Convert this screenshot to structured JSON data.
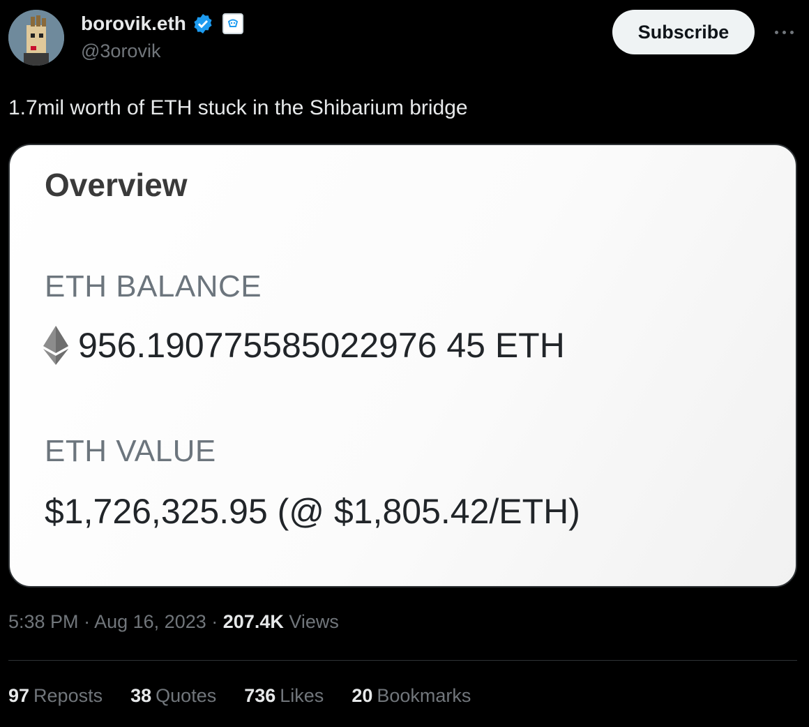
{
  "author": {
    "name": "borovik.eth",
    "handle": "@3orovik",
    "avatar_icon": "punk-avatar-icon",
    "verified_icon": "verified-badge-icon",
    "affiliation_icon": "affiliation-badge-icon"
  },
  "header": {
    "subscribe_label": "Subscribe",
    "more_icon": "more-options-icon"
  },
  "tweet": {
    "text": "1.7mil worth of ETH stuck in the Shibarium bridge"
  },
  "media": {
    "title": "Overview",
    "balance_label": "ETH BALANCE",
    "balance_value": "956.190775585022976 45 ETH",
    "value_label": "ETH VALUE",
    "value_amount": "$1,726,325.95 (@ $1,805.42/ETH)",
    "eth_icon": "ethereum-icon"
  },
  "meta": {
    "time": "5:38 PM",
    "separator": "·",
    "date": "Aug 16, 2023",
    "views_count": "207.4K",
    "views_label": "Views"
  },
  "stats": {
    "reposts_count": "97",
    "reposts_label": "Reposts",
    "quotes_count": "38",
    "quotes_label": "Quotes",
    "likes_count": "736",
    "likes_label": "Likes",
    "bookmarks_count": "20",
    "bookmarks_label": "Bookmarks"
  },
  "colors": {
    "background": "#000000",
    "text_primary": "#e7e9ea",
    "text_secondary": "#71767b",
    "verified_blue": "#1d9bf0"
  }
}
